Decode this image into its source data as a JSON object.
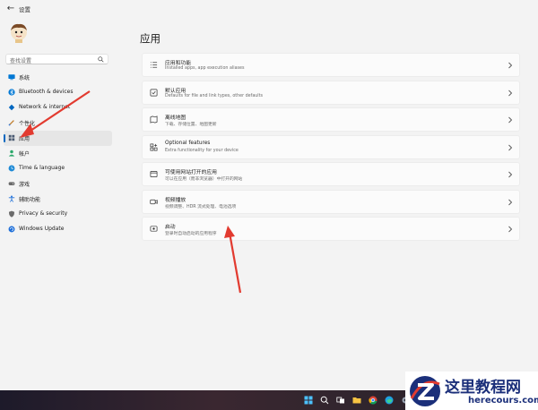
{
  "window": {
    "title": "设置"
  },
  "search": {
    "placeholder": "查找设置"
  },
  "sidebar": {
    "items": [
      {
        "label": "系统",
        "icon": "monitor-icon",
        "color": "#0078d4"
      },
      {
        "label": "Bluetooth & devices",
        "icon": "bluetooth-icon",
        "color": "#0078d4"
      },
      {
        "label": "Network & internet",
        "icon": "wifi-icon",
        "color": "#0067c0"
      },
      {
        "label": "个性化",
        "icon": "brush-icon",
        "color": "#c17c2a"
      },
      {
        "label": "应用",
        "icon": "apps-icon",
        "color": "#4a5a72",
        "active": true
      },
      {
        "label": "帐户",
        "icon": "person-icon",
        "color": "#2aa86a"
      },
      {
        "label": "Time & language",
        "icon": "globe-clock-icon",
        "color": "#1e8ad6"
      },
      {
        "label": "游戏",
        "icon": "gamepad-icon",
        "color": "#6b6b6b"
      },
      {
        "label": "辅助功能",
        "icon": "accessibility-icon",
        "color": "#1e6fd9"
      },
      {
        "label": "Privacy & security",
        "icon": "shield-icon",
        "color": "#6b6b6b"
      },
      {
        "label": "Windows Update",
        "icon": "update-icon",
        "color": "#1e6fd9"
      }
    ]
  },
  "main": {
    "title": "应用",
    "cards": [
      {
        "title": "应用和功能",
        "subtitle": "Installed apps, app execution aliases",
        "icon": "list-icon"
      },
      {
        "title": "默认应用",
        "subtitle": "Defaults for file and link types, other defaults",
        "icon": "default-apps-icon"
      },
      {
        "title": "离线地图",
        "subtitle": "下载、存储位置、地图更新",
        "icon": "map-icon"
      },
      {
        "title": "Optional features",
        "subtitle": "Extra functionality for your device",
        "icon": "grid-plus-icon"
      },
      {
        "title": "可使用网站打开的应用",
        "subtitle": "可以在应用（而非浏览器）中打开的网站",
        "icon": "web-app-icon"
      },
      {
        "title": "视频播放",
        "subtitle": "视频调整、HDR 流式处理、电池选项",
        "icon": "video-icon"
      },
      {
        "title": "启动",
        "subtitle": "登录时自动启动的应用程序",
        "icon": "startup-icon"
      }
    ]
  },
  "taskbar": {
    "icons": [
      "windows-start-icon",
      "search-icon",
      "task-view-icon",
      "file-explorer-icon",
      "chrome-icon",
      "edge-icon",
      "settings-icon"
    ]
  },
  "watermark": {
    "cn": "这里教程网",
    "en": "herecours.com"
  },
  "colors": {
    "accent": "#0067c0",
    "arrow": "#e23b30"
  }
}
